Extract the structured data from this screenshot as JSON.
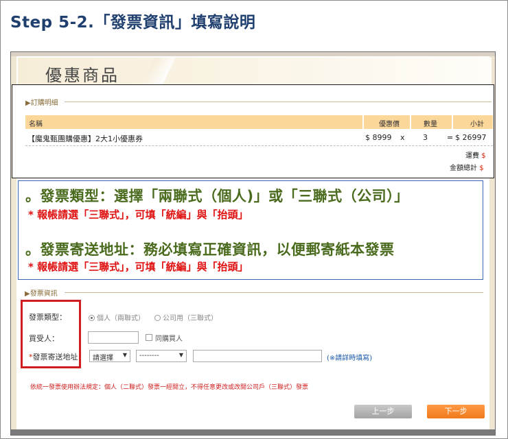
{
  "step_title": "Step 5-2.「發票資訊」填寫說明",
  "promo_title": "優惠商品",
  "order": {
    "section_title": "訂購明細",
    "columns": {
      "name": "名稱",
      "price": "優惠價",
      "qty": "數量",
      "subtotal": "小計"
    },
    "row": {
      "name": "【魔鬼甄團購優惠】2大1小優惠券",
      "price": "$ 8999",
      "times": "x",
      "qty": "3",
      "equals": "=",
      "subtotal": "$ 26997"
    },
    "shipping_label": "運費",
    "shipping_value": "$",
    "total_label": "金額總計",
    "total_value": "$"
  },
  "notice": {
    "line1": "。發票類型：選擇「兩聯式（個人)」或「三聯式（公司）」",
    "line1_sub": "* 報帳請選「三聯式」，可填「統編」與「抬頭」",
    "line2": "。發票寄送地址：務必填寫正確資訊，以便郵寄紙本發票",
    "line2_sub": "* 報帳請選「三聯式」，可填「統編」與「抬頭」"
  },
  "invoice": {
    "section_title": "發票資訊",
    "type_label": "發票類型：",
    "option_personal": "個人（兩聯式）",
    "option_company": "公司用（三聯式）",
    "buyer_label": "買受人：",
    "same_as_buyer": "同購買人",
    "address_required_mark": "*",
    "address_label": "發票寄送地址：",
    "select_city": "請選擇",
    "select_district": "--------",
    "address_hint": "(※請詳時填寫)",
    "rule_note": "依統一發票使用辦法規定：個人（二聯式）發票一經開立，不得任意更改或改開公司戶（三聯式）發票"
  },
  "buttons": {
    "prev": "上一步",
    "next": "下一步"
  },
  "colors": {
    "title_blue": "#1f3f6e",
    "notice_green": "#4a6b1d",
    "notice_red": "#e01010",
    "highlight_red": "#d01c1c",
    "next_orange": "#f07a1c",
    "header_peach": "#fbd79a"
  }
}
